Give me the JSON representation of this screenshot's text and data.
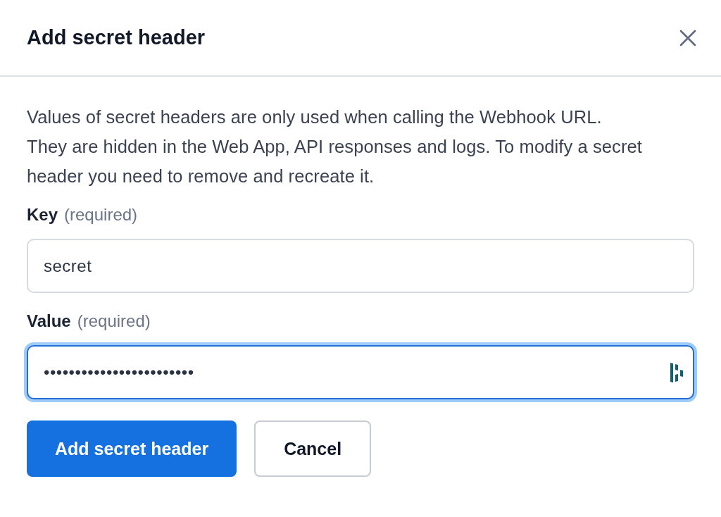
{
  "dialog": {
    "title": "Add secret header",
    "description": "Values of secret headers are only used when calling the Webhook URL. They are hidden in the Web App, API responses and logs. To modify a secret header you need to remove and recreate it.",
    "fields": [
      {
        "label": "Key",
        "hint": "(required)",
        "value": "secret",
        "focused": false
      },
      {
        "label": "Value",
        "hint": "(required)",
        "value": "••••••••••••••••••••••••",
        "focused": true
      }
    ],
    "buttons": [
      {
        "label": "Add secret header",
        "kind": "primary"
      },
      {
        "label": "Cancel",
        "kind": "secondary"
      }
    ]
  }
}
